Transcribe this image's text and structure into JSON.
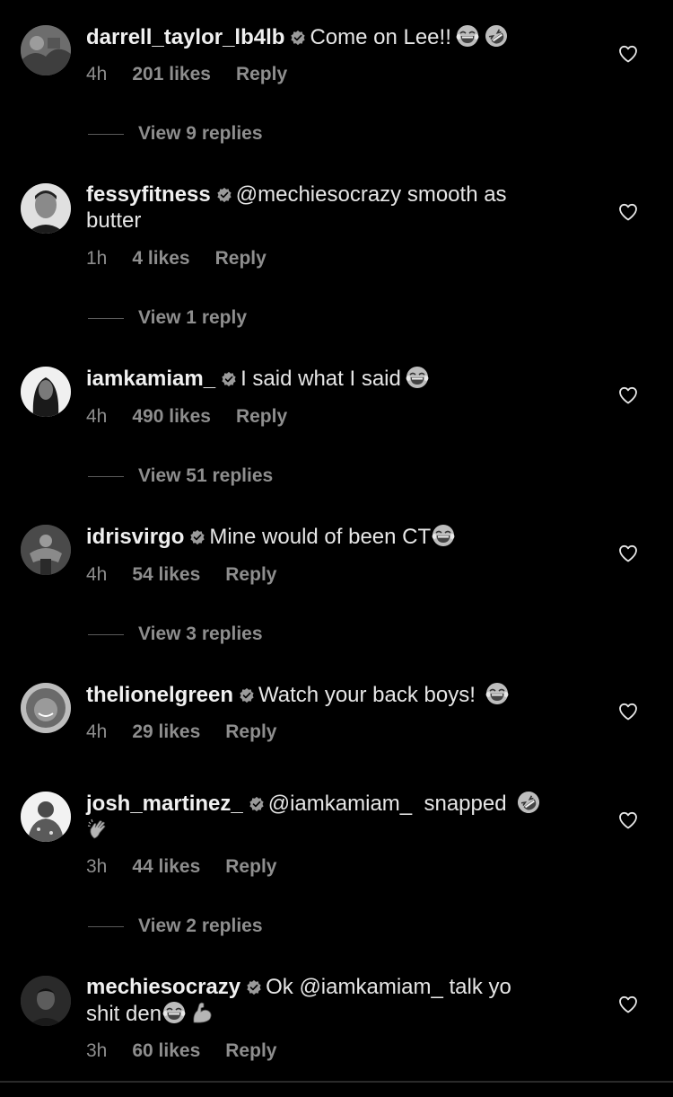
{
  "comments": [
    {
      "username": "darrell_taylor_lb4lb",
      "text": "Come on Lee!!",
      "time": "4h",
      "likes": "201 likes",
      "reply": "Reply",
      "view_replies": "View 9 replies"
    },
    {
      "username": "fessyfitness",
      "text": "@mechiesocrazy smooth as",
      "text2": "butter",
      "time": "1h",
      "likes": "4 likes",
      "reply": "Reply",
      "view_replies": "View 1 reply"
    },
    {
      "username": "iamkamiam_",
      "text": "I said what I said",
      "time": "4h",
      "likes": "490 likes",
      "reply": "Reply",
      "view_replies": "View 51 replies"
    },
    {
      "username": "idrisvirgo",
      "text": "Mine would of been CT",
      "time": "4h",
      "likes": "54 likes",
      "reply": "Reply",
      "view_replies": "View 3 replies"
    },
    {
      "username": "thelionelgreen",
      "text": "Watch your back boys!",
      "time": "4h",
      "likes": "29 likes",
      "reply": "Reply"
    },
    {
      "username": "josh_martinez_",
      "text": "@iamkamiam_  snapped",
      "time": "3h",
      "likes": "44 likes",
      "reply": "Reply",
      "view_replies": "View 2 replies"
    },
    {
      "username": "mechiesocrazy",
      "text": "Ok @iamkamiam_ talk yo",
      "text2": "shit den",
      "time": "3h",
      "likes": "60 likes",
      "reply": "Reply"
    }
  ],
  "icons": {
    "like": "heart-outline-icon",
    "verified": "verified-badge-icon"
  },
  "colors": {
    "background": "#000000",
    "text": "#e6e6e6",
    "muted": "#8e8e8e"
  }
}
